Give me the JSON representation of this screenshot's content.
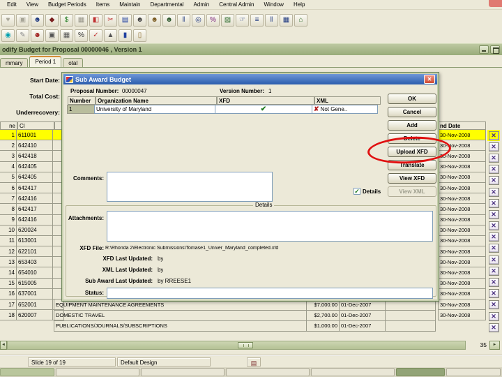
{
  "menu": {
    "items": [
      "Edit",
      "View",
      "Budget Periods",
      "Items",
      "Maintain",
      "Departmental",
      "Admin",
      "Central Admin",
      "Window",
      "Help"
    ]
  },
  "toolbar_main": {
    "icons": [
      {
        "name": "favorites-icon",
        "glyph": "♥",
        "c": "#aaa89a"
      },
      {
        "name": "copy-icon",
        "glyph": "▣",
        "c": "#a8a698"
      },
      {
        "name": "person-budget-icon",
        "glyph": "☻",
        "c": "#203a80"
      },
      {
        "name": "books-icon",
        "glyph": "◆",
        "c": "#7a1f1f"
      },
      {
        "name": "money-bag-icon",
        "glyph": "$",
        "c": "#1c7a1c"
      },
      {
        "name": "binoculars-icon",
        "glyph": "▦",
        "c": "#98968a"
      },
      {
        "name": "org-chart-icon",
        "glyph": "◧",
        "c": "#c03030"
      },
      {
        "name": "cut-icon",
        "glyph": "✂",
        "c": "#c03030"
      },
      {
        "name": "exchange-icon",
        "glyph": "▤",
        "c": "#2040a0"
      },
      {
        "name": "find-person-icon",
        "glyph": "☻",
        "c": "#444444"
      },
      {
        "name": "people-icon",
        "glyph": "☻",
        "c": "#7a5a20"
      },
      {
        "name": "person-desk-icon",
        "glyph": "☻",
        "c": "#305a30"
      },
      {
        "name": "columns-icon",
        "glyph": "‖",
        "c": "#203a80"
      },
      {
        "name": "clock-icon",
        "glyph": "◎",
        "c": "#203a80"
      },
      {
        "name": "percent-grid-icon",
        "glyph": "%",
        "c": "#7a1f7a"
      },
      {
        "name": "printer-icon",
        "glyph": "▨",
        "c": "#2a6a2a"
      },
      {
        "name": "person-go-icon",
        "glyph": "☞",
        "c": "#203a80"
      },
      {
        "name": "list-icon",
        "glyph": "≡",
        "c": "#203a80"
      },
      {
        "name": "split-view-icon",
        "glyph": "‖",
        "c": "#203a80"
      },
      {
        "name": "window-grid-icon",
        "glyph": "▦",
        "c": "#203a80"
      },
      {
        "name": "exit-door-icon",
        "glyph": "⌂",
        "c": "#2a6a2a"
      }
    ]
  },
  "toolbar_edit": {
    "icons": [
      {
        "name": "format-icon",
        "glyph": "◉",
        "c": "#00a0b0"
      },
      {
        "name": "eraser-icon",
        "glyph": "✎",
        "c": "#888888"
      },
      {
        "name": "person-alert-icon",
        "glyph": "☻",
        "c": "#a02020"
      },
      {
        "name": "save-frame-icon",
        "glyph": "▣",
        "c": "#555555"
      },
      {
        "name": "calendar-icon",
        "glyph": "▦",
        "c": "#555555"
      },
      {
        "name": "percent-icon",
        "glyph": "%",
        "c": "#333333"
      },
      {
        "name": "chart-check-icon",
        "glyph": "✓",
        "c": "#c03030"
      },
      {
        "name": "chart-wizard-icon",
        "glyph": "▲",
        "c": "#555555"
      },
      {
        "name": "save-icon",
        "glyph": "▮",
        "c": "#2040a0"
      },
      {
        "name": "clipboard-icon",
        "glyph": "▯",
        "c": "#8a6a2a"
      }
    ]
  },
  "window": {
    "title": "odify Budget for Proposal 00000046 , Version 1",
    "tabs": [
      "mmary",
      "Period 1",
      "otal"
    ]
  },
  "budget": {
    "field_labels": {
      "start_date": "Start Date:",
      "total_cost": "Total Cost:",
      "underrecovery": "Underrecovery:"
    },
    "col_headers": {
      "line": "ne",
      "cost_element": "Cl",
      "end_date": "nd Date"
    },
    "row_icon_glyph": "✕",
    "rows": [
      {
        "n": "1",
        "code": "611001",
        "end": "30-Nov-2008",
        "hl": true
      },
      {
        "n": "2",
        "code": "642410",
        "end": "30-Nov-2008"
      },
      {
        "n": "3",
        "code": "642418",
        "end": "30-Nov-2008"
      },
      {
        "n": "4",
        "code": "642405",
        "end": "30-Nov-2008"
      },
      {
        "n": "5",
        "code": "642405",
        "end": "30-Nov-2008"
      },
      {
        "n": "6",
        "code": "642417",
        "end": "30-Nov-2008"
      },
      {
        "n": "7",
        "code": "642416",
        "end": "30-Nov-2008"
      },
      {
        "n": "8",
        "code": "642417",
        "end": "30-Nov-2008"
      },
      {
        "n": "9",
        "code": "642416",
        "end": "30-Nov-2008"
      },
      {
        "n": "10",
        "code": "620024",
        "end": "30-Nov-2008"
      },
      {
        "n": "11",
        "code": "613001",
        "end": "30-Nov-2008"
      },
      {
        "n": "12",
        "code": "622101",
        "end": "30-Nov-2008"
      },
      {
        "n": "13",
        "code": "653403",
        "end": "30-Nov-2008"
      },
      {
        "n": "14",
        "code": "654010",
        "end": "30-Nov-2008"
      },
      {
        "n": "15",
        "code": "615005",
        "end": "30-Nov-2008"
      },
      {
        "n": "16",
        "code": "637001",
        "end": "30-Nov-2008",
        "desc": "EQUIPMENT MAINTENANCE AGREEMENTS",
        "cost": "$7,000.00",
        "start": "01-Dec-2007"
      },
      {
        "n": "17",
        "code": "652001",
        "end": "30-Nov-2008",
        "desc": "DOMESTIC TRAVEL",
        "cost": "$2,700.00",
        "start": "01-Dec-2007"
      },
      {
        "n": "18",
        "code": "620007",
        "end": "30-Nov-2008",
        "desc": "PUBLICATIONS/JOURNALS/SUBSCRIPTIONS",
        "cost": "$1,000.00",
        "start": "01-Dec-2007"
      }
    ],
    "scroll": {
      "left": "◄",
      "right": "►",
      "count": "35"
    }
  },
  "dialog": {
    "title": "Sub Award Budget",
    "close_glyph": "✕",
    "proposal_label": "Proposal Number:",
    "proposal_value": "00000047",
    "version_label": "Version Number:",
    "version_value": "1",
    "grid": {
      "headers": [
        "Number",
        "Organization Name",
        "XFD",
        "XML"
      ],
      "row": {
        "number": "1",
        "organization": "University of Maryland",
        "xfd_check_glyph": "✔",
        "xml_x_glyph": "✘",
        "xml_status": "Not Gene.."
      }
    },
    "buttons": [
      "OK",
      "Cancel",
      "Add",
      "Delete",
      "Upload XFD",
      "Translate",
      "View XFD",
      "View XML"
    ],
    "comments_label": "Comments:",
    "details_checkbox_label": "Details",
    "details_checkbox_glyph": "✓",
    "details_group_label": "Details",
    "attachments_label": "Attachments:",
    "xfd_file_label": "XFD File:",
    "xfd_file_value": "R:\\Rhonda 2\\Electronic Submissions\\Tomase1_Univer_Maryland_completed.xfd",
    "xfd_updated_label": "XFD Last Updated:",
    "xfd_updated_value": "by",
    "xml_updated_label": "XML Last Updated:",
    "xml_updated_value": "by",
    "subaward_updated_label": "Sub Award Last Updated:",
    "subaward_updated_value": "by  RREESE1",
    "status_label": "Status:"
  },
  "statusbar": {
    "slide": "Slide 19 of 19",
    "design": "Default Design",
    "spell_icon": "▤"
  },
  "colors": {
    "title_olive": "#98ab79",
    "dialog_title_blue": "#2a5cad",
    "highlight_yellow": "#ffff00",
    "annotation_red": "#e01010",
    "check_green": "#1e7a1e",
    "x_red": "#b01818"
  }
}
